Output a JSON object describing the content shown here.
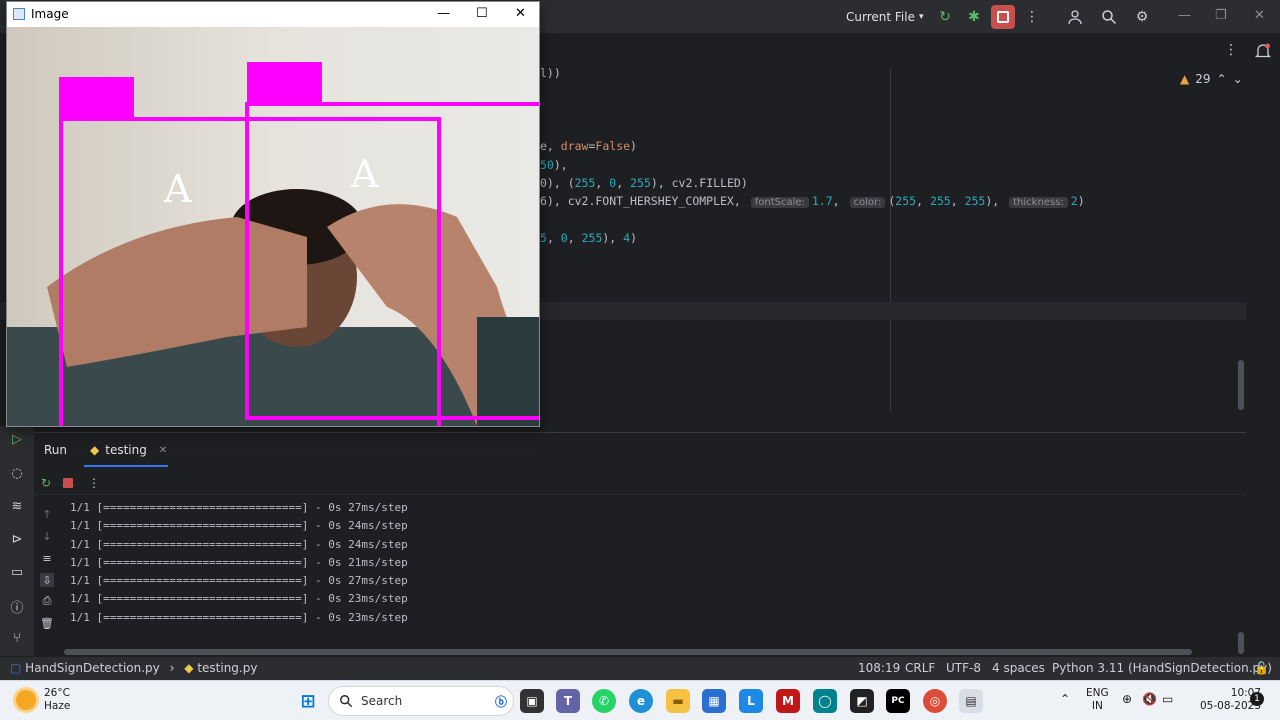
{
  "ide": {
    "run_config": "Current File",
    "warnings_count": "29",
    "code_lines": [
      {
        "id": "l1",
        "parts": [
          {
            "t": "l))",
            "c": ""
          }
        ]
      },
      {
        "id": "l2",
        "parts": [
          {
            "t": "e, ",
            "c": ""
          },
          {
            "t": "draw",
            "c": "kw"
          },
          {
            "t": "=",
            "c": ""
          },
          {
            "t": "False",
            "c": "kw"
          },
          {
            "t": ")",
            "c": ""
          }
        ]
      },
      {
        "id": "l3",
        "parts": [
          {
            "t": "50",
            "c": "num"
          },
          {
            "t": "),",
            "c": ""
          }
        ]
      },
      {
        "id": "l4",
        "parts": [
          {
            "t": "0), (",
            "c": ""
          },
          {
            "t": "255",
            "c": "num"
          },
          {
            "t": ", ",
            "c": ""
          },
          {
            "t": "0",
            "c": "num"
          },
          {
            "t": ", ",
            "c": ""
          },
          {
            "t": "255",
            "c": "num"
          },
          {
            "t": "), cv2.FILLED)",
            "c": ""
          }
        ]
      },
      {
        "id": "l5",
        "parts": [
          {
            "t": "6), cv2.FONT_HERSHEY_COMPLEX, ",
            "c": ""
          },
          {
            "t": "fontScale:",
            "c": "hint"
          },
          {
            "t": "1.7",
            "c": "num"
          },
          {
            "t": ", ",
            "c": ""
          },
          {
            "t": "color:",
            "c": "hint"
          },
          {
            "t": "(",
            "c": ""
          },
          {
            "t": "255",
            "c": "num"
          },
          {
            "t": ", ",
            "c": ""
          },
          {
            "t": "255",
            "c": "num"
          },
          {
            "t": ", ",
            "c": ""
          },
          {
            "t": "255",
            "c": "num"
          },
          {
            "t": "), ",
            "c": ""
          },
          {
            "t": "thickness:",
            "c": "hint"
          },
          {
            "t": "2",
            "c": "num"
          },
          {
            "t": ")",
            "c": ""
          }
        ]
      },
      {
        "id": "l6",
        "parts": [
          {
            "t": "5",
            "c": "num"
          },
          {
            "t": ", ",
            "c": ""
          },
          {
            "t": "0",
            "c": "num"
          },
          {
            "t": ", ",
            "c": ""
          },
          {
            "t": "255",
            "c": "num"
          },
          {
            "t": "), ",
            "c": ""
          },
          {
            "t": "4",
            "c": "num"
          },
          {
            "t": ")",
            "c": ""
          }
        ]
      }
    ]
  },
  "run_panel": {
    "title": "Run",
    "tab_label": "testing",
    "console_lines": [
      "1/1 [==============================] - 0s 27ms/step",
      "1/1 [==============================] - 0s 24ms/step",
      "1/1 [==============================] - 0s 24ms/step",
      "1/1 [==============================] - 0s 21ms/step",
      "1/1 [==============================] - 0s 27ms/step",
      "1/1 [==============================] - 0s 23ms/step",
      "1/1 [==============================] - 0s 23ms/step"
    ]
  },
  "statusbar": {
    "project": "HandSignDetection.py",
    "file": "testing.py",
    "position": "108:19",
    "line_ending": "CRLF",
    "encoding": "UTF-8",
    "indent": "4 spaces",
    "interpreter": "Python 3.11 (HandSignDetection.py)"
  },
  "image_window": {
    "title": "Image",
    "labels": [
      "A",
      "A"
    ],
    "overlay_color": "#ff00ff"
  },
  "taskbar": {
    "temperature": "26°C",
    "weather": "Haze",
    "search_placeholder": "Search",
    "lang_line1": "ENG",
    "lang_line2": "IN",
    "time": "10:07",
    "date": "05-08-2023",
    "notifications": "1"
  }
}
